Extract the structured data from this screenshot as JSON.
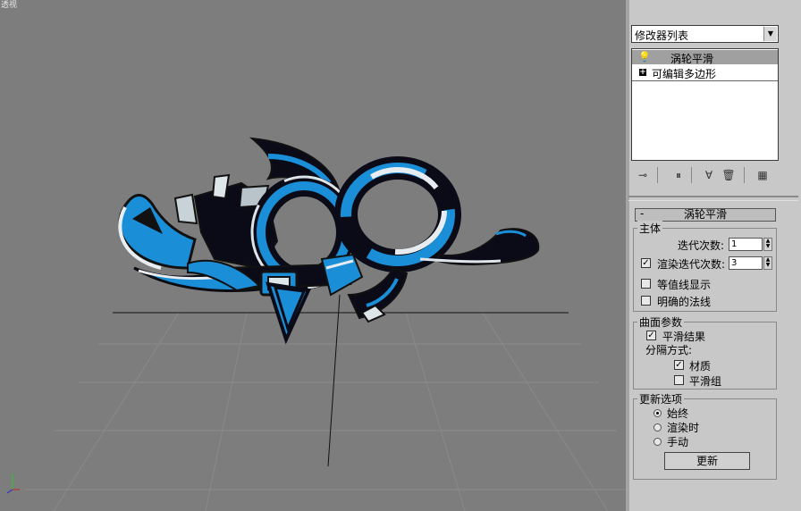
{
  "viewport": {
    "label": "透视"
  },
  "panel": {
    "modifier_list": "修改器列表",
    "stack": {
      "item_active": "涡轮平滑",
      "item_base": "可编辑多边形"
    },
    "rollout_title": "涡轮平滑",
    "main": {
      "title": "主体",
      "iterations_label": "迭代次数:",
      "iterations_value": "1",
      "render_iters_label": "渲染迭代次数:",
      "render_iters_value": "3",
      "render_iters_checked": true,
      "isoline_label": "等值线显示",
      "explicit_normals_label": "明确的法线"
    },
    "surface": {
      "title": "曲面参数",
      "smooth_result_label": "平滑结果",
      "separate_by_label": "分隔方式:",
      "materials_label": "材质",
      "smoothing_groups_label": "平滑组"
    },
    "update": {
      "title": "更新选项",
      "always_label": "始终",
      "when_rendering_label": "渲染时",
      "manually_label": "手动",
      "update_button": "更新"
    }
  },
  "colors": {
    "viewport_bg": "#7d7d7d",
    "panel_bg": "#c8c8c8",
    "accent_blue": "#1a8fd8"
  }
}
